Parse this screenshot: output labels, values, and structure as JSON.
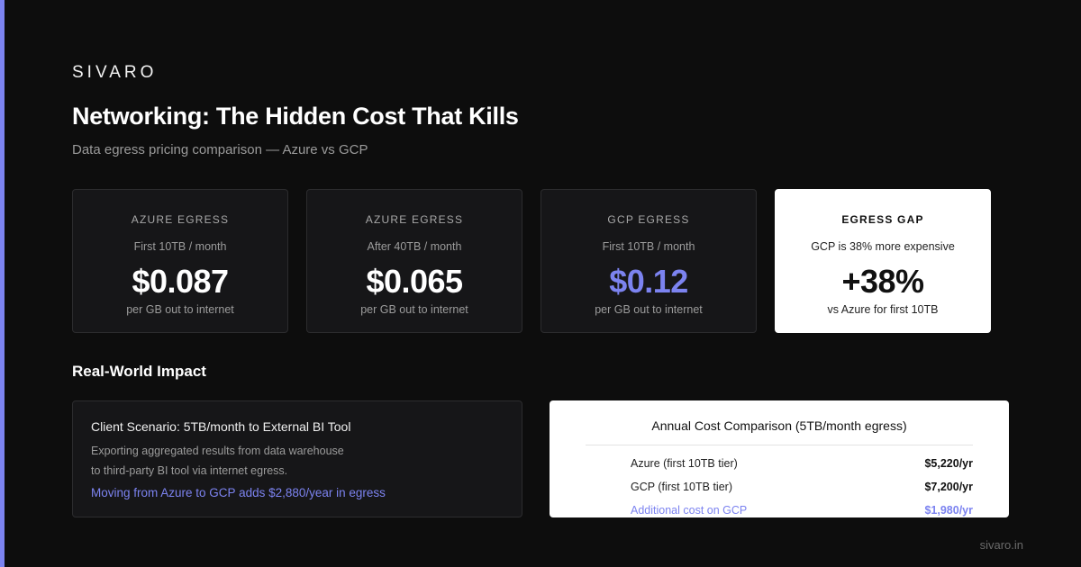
{
  "brand": "SIVARO",
  "title": "Networking: The Hidden Cost That Kills",
  "subtitle": "Data egress pricing comparison — Azure vs GCP",
  "cards": [
    {
      "label": "AZURE EGRESS",
      "sub": "First 10TB / month",
      "value": "$0.087",
      "note": "per GB out to internet"
    },
    {
      "label": "AZURE EGRESS",
      "sub": "After 40TB / month",
      "value": "$0.065",
      "note": "per GB out to internet"
    },
    {
      "label": "GCP EGRESS",
      "sub": "First 10TB / month",
      "value": "$0.12",
      "note": "per GB out to internet"
    },
    {
      "label": "EGRESS GAP",
      "sub": "GCP is 38% more expensive",
      "value": "+38%",
      "note": "vs Azure for first 10TB"
    }
  ],
  "impact": {
    "section_title": "Real-World Impact",
    "scenario_title": "Client Scenario: 5TB/month to External BI Tool",
    "desc_line1": "Exporting aggregated results from data warehouse",
    "desc_line2": "to third-party BI tool via internet egress.",
    "highlight": "Moving from Azure to GCP adds $2,880/year in egress"
  },
  "comparison": {
    "title": "Annual Cost Comparison (5TB/month egress)",
    "rows": [
      {
        "label": "Azure (first 10TB tier)",
        "amount": "$5,220/yr"
      },
      {
        "label": "GCP (first 10TB tier)",
        "amount": "$7,200/yr"
      },
      {
        "label": "Additional cost on GCP",
        "amount": "$1,980/yr"
      }
    ]
  },
  "footer": "sivaro.in",
  "colors": {
    "accent": "#7c83f0",
    "background": "#0d0d0d",
    "card": "#161618"
  }
}
